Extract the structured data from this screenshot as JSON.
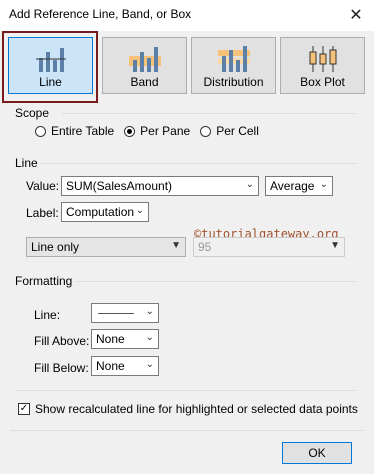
{
  "window": {
    "title": "Add Reference Line, Band, or Box",
    "close_glyph": "✕"
  },
  "types": [
    {
      "label": "Line",
      "selected": true
    },
    {
      "label": "Band",
      "selected": false
    },
    {
      "label": "Distribution",
      "selected": false
    },
    {
      "label": "Box Plot",
      "selected": false
    }
  ],
  "scope": {
    "title": "Scope",
    "options": [
      "Entire Table",
      "Per Pane",
      "Per Cell"
    ],
    "selected": "Per Pane"
  },
  "line": {
    "title": "Line",
    "value_label": "Value:",
    "value": "SUM(SalesAmount)",
    "aggregation": "Average",
    "label_label": "Label:",
    "label_value": "Computation",
    "mode": "Line only",
    "confidence": "95"
  },
  "watermark": "©tutorialgateway.org",
  "formatting": {
    "title": "Formatting",
    "line_label": "Line:",
    "fill_above_label": "Fill Above:",
    "fill_above": "None",
    "fill_below_label": "Fill Below:",
    "fill_below": "None"
  },
  "options": {
    "show_recalc": "Show recalculated line for highlighted or selected data points",
    "show_recalc_checked": true,
    "check_glyph": "✓"
  },
  "ok_label": "OK",
  "colors": {
    "selected_tile": "#cce4f7",
    "accent": "#0078d7",
    "highlight_frame": "#7a1a1d",
    "bars": "#5b7fa6",
    "band": "#f6c27a"
  }
}
